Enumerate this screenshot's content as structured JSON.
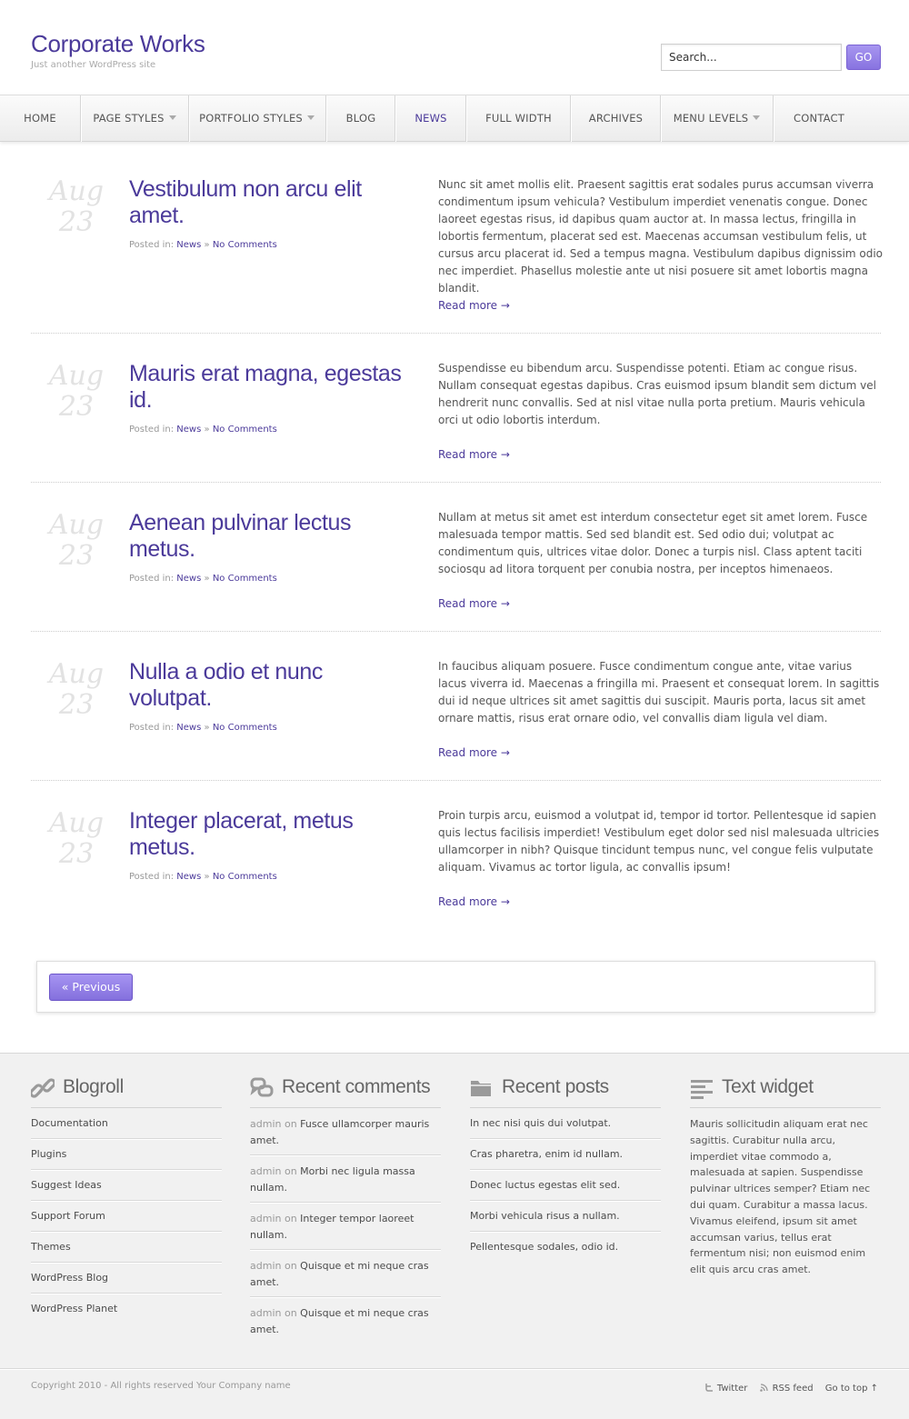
{
  "header": {
    "site_title": "Corporate Works",
    "tagline": "Just another WordPress site",
    "search_value": "Search...",
    "search_button": "GO"
  },
  "nav": {
    "items": [
      {
        "label": "HOME"
      },
      {
        "label": "PAGE STYLES"
      },
      {
        "label": "PORTFOLIO STYLES"
      },
      {
        "label": "BLOG"
      },
      {
        "label": "NEWS"
      },
      {
        "label": "FULL WIDTH"
      },
      {
        "label": "ARCHIVES"
      },
      {
        "label": "MENU LEVELS"
      },
      {
        "label": "CONTACT"
      }
    ]
  },
  "posts": [
    {
      "month": "Aug",
      "day": "23",
      "title": "Vestibulum non arcu elit amet.",
      "posted_in": "Posted in:",
      "category": "News",
      "sep": "»",
      "comments": "No Comments",
      "excerpt": "Nunc sit amet mollis elit. Praesent sagittis erat sodales purus accumsan viverra condimentum ipsum vehicula? Vestibulum imperdiet venenatis congue. Donec laoreet egestas risus, id dapibus quam auctor at. In massa lectus, fringilla in lobortis fermentum, placerat sed est. Maecenas accumsan vestibulum felis, ut cursus arcu placerat id. Sed a tempus magna. Vestibulum dapibus dignissim odio nec imperdiet. Phasellus molestie ante ut nisi posuere sit amet lobortis magna blandit.",
      "read_more": "Read more →"
    },
    {
      "month": "Aug",
      "day": "23",
      "title": "Mauris erat magna, egestas id.",
      "posted_in": "Posted in:",
      "category": "News",
      "sep": "»",
      "comments": "No Comments",
      "excerpt": "Suspendisse eu bibendum arcu. Suspendisse potenti. Etiam ac congue risus. Nullam consequat egestas dapibus. Cras euismod ipsum blandit sem dictum vel hendrerit nunc convallis. Sed at nisl vitae nulla porta pretium. Mauris vehicula orci ut odio lobortis interdum.",
      "read_more": "Read more →"
    },
    {
      "month": "Aug",
      "day": "23",
      "title": "Aenean pulvinar lectus metus.",
      "posted_in": "Posted in:",
      "category": "News",
      "sep": "»",
      "comments": "No Comments",
      "excerpt": "Nullam at metus sit amet est interdum consectetur eget sit amet lorem. Fusce malesuada tempor mattis. Sed sed blandit est. Sed odio dui; volutpat ac condimentum quis, ultrices vitae dolor. Donec a turpis nisl. Class aptent taciti sociosqu ad litora torquent per conubia nostra, per inceptos himenaeos.",
      "read_more": "Read more →"
    },
    {
      "month": "Aug",
      "day": "23",
      "title": "Nulla a odio et nunc volutpat.",
      "posted_in": "Posted in:",
      "category": "News",
      "sep": "»",
      "comments": "No Comments",
      "excerpt": "In faucibus aliquam posuere. Fusce condimentum congue ante, vitae varius lacus viverra id. Maecenas a fringilla mi. Praesent et consequat lorem. In sagittis dui id neque ultrices sit amet sagittis dui suscipit. Mauris porta, lacus sit amet ornare mattis, risus erat ornare odio, vel convallis diam ligula vel diam.",
      "read_more": "Read more →"
    },
    {
      "month": "Aug",
      "day": "23",
      "title": "Integer placerat, metus metus.",
      "posted_in": "Posted in:",
      "category": "News",
      "sep": "»",
      "comments": "No Comments",
      "excerpt": "Proin turpis arcu, euismod a volutpat id, tempor id tortor. Pellentesque id sapien quis lectus facilisis imperdiet! Vestibulum eget dolor sed nisl malesuada ultricies ullamcorper in nibh? Quisque tincidunt tempus nunc, vel congue felis vulputate aliquam. Vivamus ac tortor ligula, ac convallis ipsum!",
      "read_more": "Read more →"
    }
  ],
  "pagination": {
    "previous": "« Previous"
  },
  "footer": {
    "blogroll": {
      "title": "Blogroll",
      "items": [
        "Documentation",
        "Plugins",
        "Suggest Ideas",
        "Support Forum",
        "Themes",
        "WordPress Blog",
        "WordPress Planet"
      ]
    },
    "recent_comments": {
      "title": "Recent comments",
      "items": [
        {
          "author": "admin",
          "on": "on",
          "post": "Fusce ullamcorper mauris amet."
        },
        {
          "author": "admin",
          "on": "on",
          "post": "Morbi nec ligula massa nullam."
        },
        {
          "author": "admin",
          "on": "on",
          "post": "Integer tempor laoreet nullam."
        },
        {
          "author": "admin",
          "on": "on",
          "post": "Quisque et mi neque cras amet."
        },
        {
          "author": "admin",
          "on": "on",
          "post": "Quisque et mi neque cras amet."
        }
      ]
    },
    "recent_posts": {
      "title": "Recent posts",
      "items": [
        "In nec nisi quis dui volutpat.",
        "Cras pharetra, enim id nullam.",
        "Donec luctus egestas elit sed.",
        "Morbi vehicula risus a nullam.",
        "Pellentesque sodales, odio id."
      ]
    },
    "text_widget": {
      "title": "Text widget",
      "text": "Mauris sollicitudin aliquam erat nec sagittis. Curabitur nulla arcu, imperdiet vitae commodo a, malesuada at sapien. Suspendisse pulvinar ultrices semper? Etiam nec dui quam. Curabitur a massa lacus. Vivamus eleifend, ipsum sit amet accumsan varius, tellus erat fermentum nisi; non euismod enim elit quis arcu cras amet."
    }
  },
  "bottom": {
    "copyright": "Copyright 2010 - All rights reserved Your Company name",
    "twitter": "Twitter",
    "rss": "RSS feed",
    "top": "Go to top ↑"
  }
}
